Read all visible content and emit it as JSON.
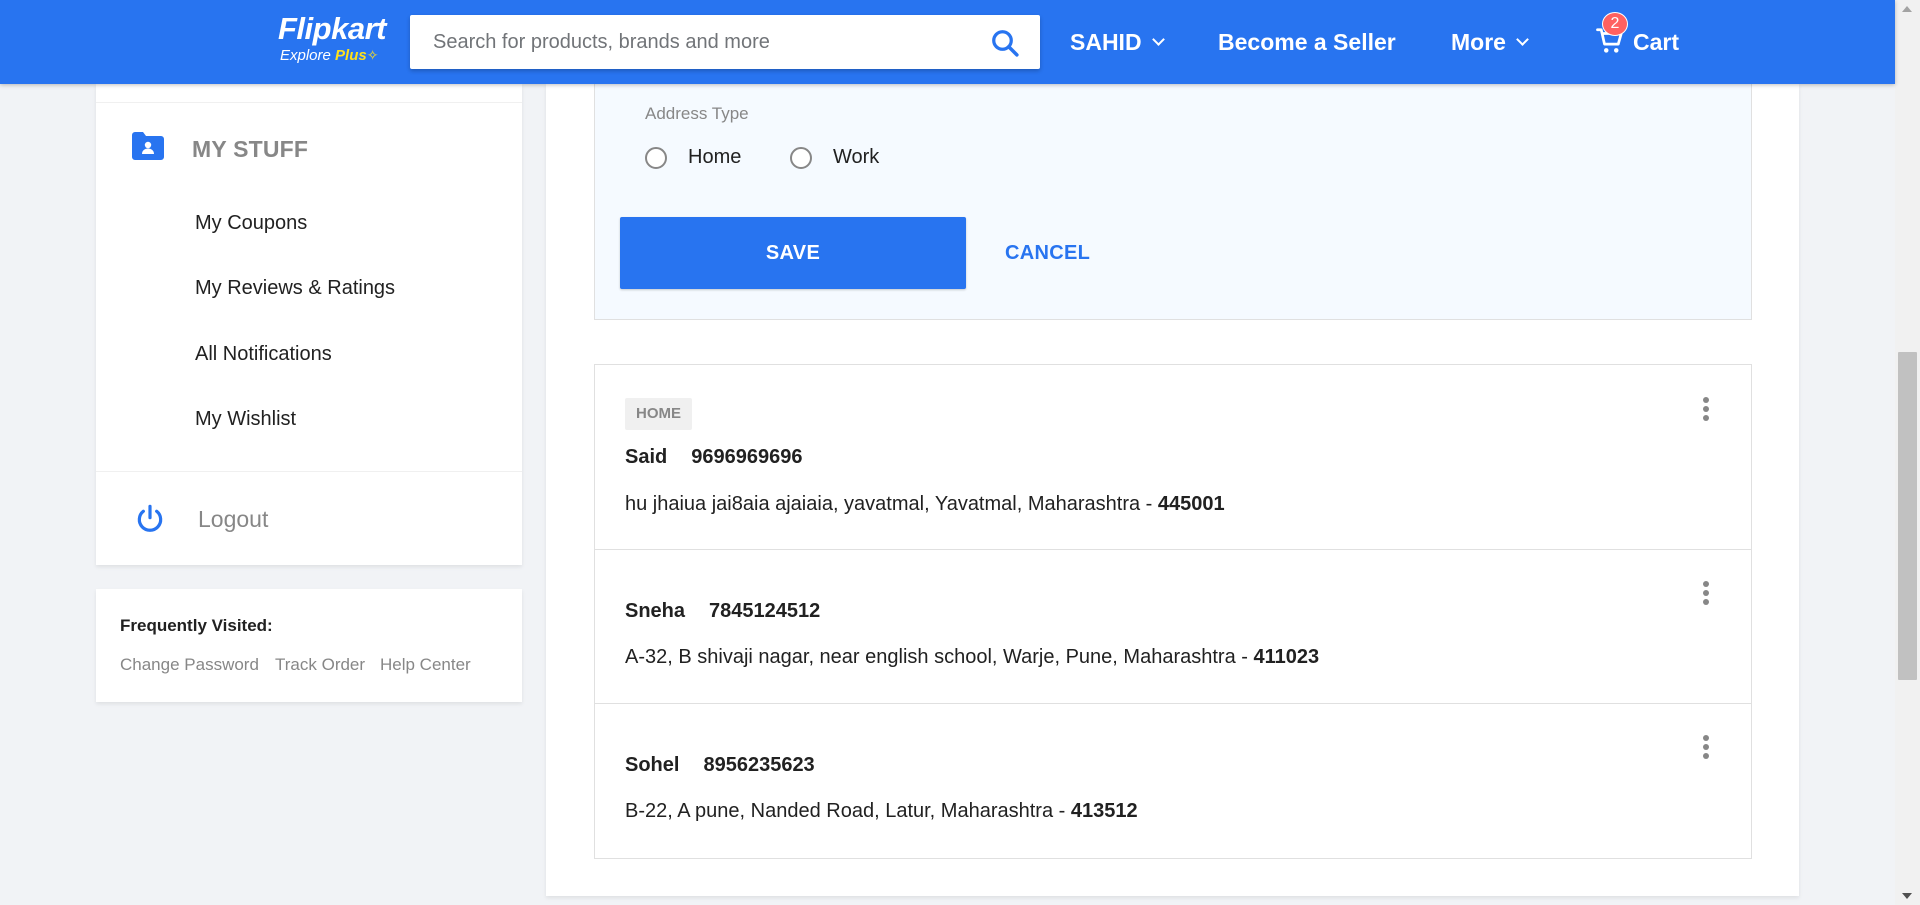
{
  "header": {
    "logo_main": "Flipkart",
    "logo_explore": "Explore",
    "logo_plus": "Plus",
    "search_placeholder": "Search for products, brands and more",
    "user_label": "SAHID",
    "seller_label": "Become a Seller",
    "more_label": "More",
    "cart_label": "Cart",
    "cart_count": "2"
  },
  "sidebar": {
    "section_title": "MY STUFF",
    "items": [
      {
        "label": "My Coupons"
      },
      {
        "label": "My Reviews & Ratings"
      },
      {
        "label": "All Notifications"
      },
      {
        "label": "My Wishlist"
      }
    ],
    "logout_label": "Logout",
    "frequently": {
      "title": "Frequently Visited:",
      "links": [
        "Change Password",
        "Track Order",
        "Help Center"
      ]
    }
  },
  "form": {
    "address_type_label": "Address Type",
    "options": [
      "Home",
      "Work"
    ],
    "save_label": "SAVE",
    "cancel_label": "CANCEL"
  },
  "addresses": [
    {
      "tag": "HOME",
      "name": "Said",
      "phone": "9696969696",
      "address": "hu jhaiua jai8aia ajaiaia, yavatmal, Yavatmal, Maharashtra - ",
      "pincode": "445001"
    },
    {
      "name": "Sneha",
      "phone": "7845124512",
      "address": "A-32, B shivaji nagar, near english school, Warje, Pune, Maharashtra - ",
      "pincode": "411023"
    },
    {
      "name": "Sohel",
      "phone": "8956235623",
      "address": "B-22, A pune, Nanded Road, Latur, Maharashtra - ",
      "pincode": "413512"
    }
  ],
  "colors": {
    "brand_blue": "#2874f0",
    "accent_yellow": "#ffe11b",
    "badge_red": "#ff6161"
  }
}
